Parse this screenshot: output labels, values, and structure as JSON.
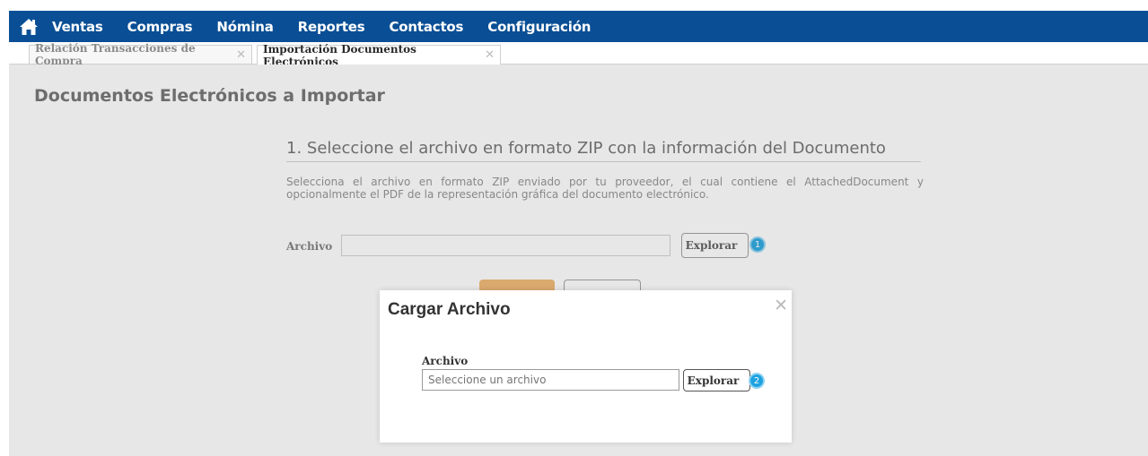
{
  "nav": {
    "home_icon": "home-icon",
    "items": [
      "Ventas",
      "Compras",
      "Nómina",
      "Reportes",
      "Contactos",
      "Configuración"
    ]
  },
  "tabs": [
    {
      "label": "Relación Transacciones de Compra",
      "close": "✕"
    },
    {
      "label": "Importación Documentos Electrónicos",
      "close": "✕"
    }
  ],
  "page": {
    "title": "Documentos Electrónicos a Importar",
    "step_title": "1. Seleccione el archivo en formato ZIP con la información del Documento",
    "description": "Selecciona el archivo en formato ZIP enviado por tu proveedor, el cual contiene el AttachedDocument y opcionalmente el PDF de la representación gráfica del documento electrónico.",
    "file_label": "Archivo",
    "file_value": "",
    "browse_label": "Explorar",
    "browse_badge": "1"
  },
  "modal": {
    "title": "Cargar Archivo",
    "close": "✕",
    "file_label": "Archivo",
    "file_placeholder": "Seleccione un archivo",
    "browse_label": "Explorar",
    "browse_badge": "2"
  },
  "colors": {
    "navbar": "#0a4f95",
    "badge": "#1ea3e0",
    "import_button": "#f0b46c"
  }
}
